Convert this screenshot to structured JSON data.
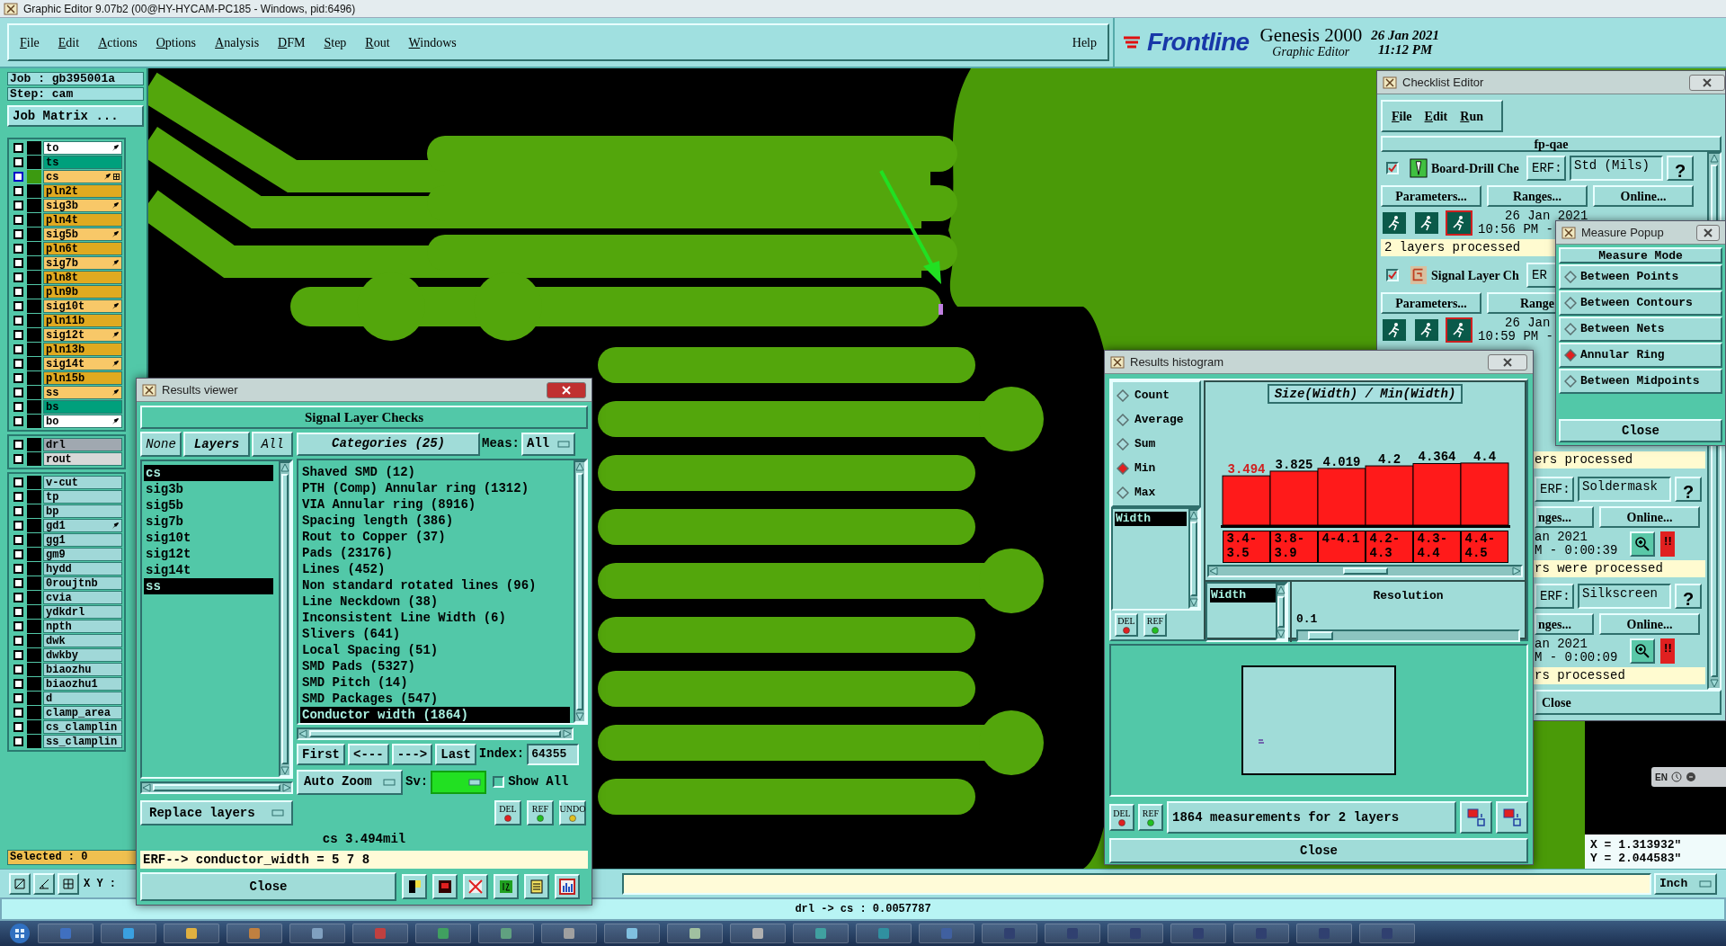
{
  "window": {
    "title": "Graphic Editor 9.07b2 (00@HY-HYCAM-PC185 - Windows, pid:6496)"
  },
  "menu": [
    "File",
    "Edit",
    "Actions",
    "Options",
    "Analysis",
    "DFM",
    "Step",
    "Rout",
    "Windows"
  ],
  "help": "Help",
  "brand": {
    "logo": "Frontline",
    "product": "Genesis 2000",
    "subtitle": "Graphic Editor",
    "date": "26 Jan 2021",
    "time": "11:12 PM"
  },
  "job": {
    "job": "Job : gb395001a",
    "step": "Step: cam",
    "matrix_button": "Job Matrix ..."
  },
  "layer_groups": [
    {
      "layers": [
        {
          "name": "to",
          "color": "#ffffff",
          "checked": false,
          "marked": true,
          "active": false
        },
        {
          "name": "ts",
          "color": "#00a07c",
          "checked": false,
          "marked": false,
          "active": false
        },
        {
          "name": "cs",
          "color": "#f8c868",
          "checked": false,
          "marked": true,
          "active": true
        },
        {
          "name": "pln2t",
          "color": "#e0aa20",
          "checked": false,
          "marked": false,
          "active": false
        },
        {
          "name": "sig3b",
          "color": "#f8c868",
          "checked": false,
          "marked": true,
          "active": false
        },
        {
          "name": "pln4t",
          "color": "#e0aa20",
          "checked": false,
          "marked": false,
          "active": false
        },
        {
          "name": "sig5b",
          "color": "#f8c868",
          "checked": false,
          "marked": true,
          "active": false
        },
        {
          "name": "pln6t",
          "color": "#e0aa20",
          "checked": false,
          "marked": false,
          "active": false
        },
        {
          "name": "sig7b",
          "color": "#f8c868",
          "checked": false,
          "marked": true,
          "active": false
        },
        {
          "name": "pln8t",
          "color": "#e0aa20",
          "checked": false,
          "marked": false,
          "active": false
        },
        {
          "name": "pln9b",
          "color": "#e0aa20",
          "checked": false,
          "marked": false,
          "active": false
        },
        {
          "name": "sig10t",
          "color": "#f8c868",
          "checked": false,
          "marked": true,
          "active": false
        },
        {
          "name": "pln11b",
          "color": "#e0aa20",
          "checked": false,
          "marked": false,
          "active": false
        },
        {
          "name": "sig12t",
          "color": "#f8c868",
          "checked": false,
          "marked": true,
          "active": false
        },
        {
          "name": "pln13b",
          "color": "#e0aa20",
          "checked": false,
          "marked": false,
          "active": false
        },
        {
          "name": "sig14t",
          "color": "#f8c868",
          "checked": false,
          "marked": true,
          "active": false
        },
        {
          "name": "pln15b",
          "color": "#e0aa20",
          "checked": false,
          "marked": false,
          "active": false
        },
        {
          "name": "ss",
          "color": "#f8c868",
          "checked": false,
          "marked": true,
          "active": false
        },
        {
          "name": "bs",
          "color": "#00a07c",
          "checked": false,
          "marked": false,
          "active": false
        },
        {
          "name": "bo",
          "color": "#ffffff",
          "checked": false,
          "marked": true,
          "active": false
        }
      ]
    },
    {
      "layers": [
        {
          "name": "drl",
          "color": "#a0a8b0",
          "checked": false,
          "marked": false,
          "active": false
        },
        {
          "name": "rout",
          "color": "#d8d8d8",
          "checked": false,
          "marked": false,
          "active": false
        }
      ]
    },
    {
      "layers": [
        {
          "name": "v-cut",
          "color": "#a0d8d8",
          "checked": false,
          "marked": false,
          "active": false
        },
        {
          "name": "tp",
          "color": "#a0d8d8",
          "checked": false,
          "marked": false,
          "active": false
        },
        {
          "name": "bp",
          "color": "#a0d8d8",
          "checked": false,
          "marked": false,
          "active": false
        },
        {
          "name": "gd1",
          "color": "#a0d8d8",
          "checked": false,
          "marked": true,
          "active": false
        },
        {
          "name": "gg1",
          "color": "#a0d8d8",
          "checked": false,
          "marked": false,
          "active": false
        },
        {
          "name": "gm9",
          "color": "#a0d8d8",
          "checked": false,
          "marked": false,
          "active": false
        },
        {
          "name": "hydd",
          "color": "#a0d8d8",
          "checked": false,
          "marked": false,
          "active": false
        },
        {
          "name": "0roujtnb",
          "color": "#a0d8d8",
          "checked": false,
          "marked": false,
          "active": false
        },
        {
          "name": "cvia",
          "color": "#a0d8d8",
          "checked": false,
          "marked": false,
          "active": false
        },
        {
          "name": "ydkdrl",
          "color": "#a0d8d8",
          "checked": false,
          "marked": false,
          "active": false
        },
        {
          "name": "npth",
          "color": "#a0d8d8",
          "checked": false,
          "marked": false,
          "active": false
        },
        {
          "name": "dwk",
          "color": "#a0d8d8",
          "checked": false,
          "marked": false,
          "active": false
        },
        {
          "name": "dwkby",
          "color": "#a0d8d8",
          "checked": false,
          "marked": false,
          "active": false
        },
        {
          "name": "biaozhu",
          "color": "#a0d8d8",
          "checked": false,
          "marked": false,
          "active": false
        },
        {
          "name": "biaozhu1",
          "color": "#a0d8d8",
          "checked": false,
          "marked": false,
          "active": false
        },
        {
          "name": "d",
          "color": "#a0d8d8",
          "checked": false,
          "marked": false,
          "active": false
        },
        {
          "name": "clamp_area",
          "color": "#a0d8d8",
          "checked": false,
          "marked": false,
          "active": false
        },
        {
          "name": "cs_clamplin",
          "color": "#a0d8d8",
          "checked": false,
          "marked": false,
          "active": false
        },
        {
          "name": "ss_clamplin",
          "color": "#a0d8d8",
          "checked": false,
          "marked": false,
          "active": false
        }
      ]
    }
  ],
  "selected_count": "Selected : 0",
  "toolbar": {
    "xy_label": "X Y :",
    "units": "Inch"
  },
  "status_bar": "drl -> cs : 0.0057787",
  "coordinates": {
    "language": "EN",
    "x": "X = 1.313932\"",
    "y": "Y = 2.044583\""
  },
  "results_viewer": {
    "title": "Results viewer",
    "heading": "Signal Layer Checks",
    "layer_buttons": [
      "None",
      "Layers",
      "All"
    ],
    "layers": [
      {
        "label": "cs",
        "selected": true
      },
      {
        "label": "sig3b",
        "selected": false
      },
      {
        "label": "sig5b",
        "selected": false
      },
      {
        "label": "sig7b",
        "selected": false
      },
      {
        "label": "sig10t",
        "selected": false
      },
      {
        "label": "sig12t",
        "selected": false
      },
      {
        "label": "sig14t",
        "selected": false
      },
      {
        "label": "ss",
        "selected": true
      }
    ],
    "categories_button": "Categories (25)",
    "meas_label": "Meas:",
    "meas_value": "All",
    "categories": [
      {
        "label": "Shaved SMD (12)",
        "selected": false
      },
      {
        "label": "PTH (Comp) Annular ring (1312)",
        "selected": false
      },
      {
        "label": "VIA Annular ring (8916)",
        "selected": false
      },
      {
        "label": "Spacing length (386)",
        "selected": false
      },
      {
        "label": "Rout to Copper (37)",
        "selected": false
      },
      {
        "label": "Pads (23176)",
        "selected": false
      },
      {
        "label": "Lines (452)",
        "selected": false
      },
      {
        "label": "Non standard rotated lines (96)",
        "selected": false
      },
      {
        "label": "Line Neckdown (38)",
        "selected": false
      },
      {
        "label": "Inconsistent Line Width (6)",
        "selected": false
      },
      {
        "label": "Slivers (641)",
        "selected": false
      },
      {
        "label": "Local Spacing (51)",
        "selected": false
      },
      {
        "label": "SMD Pads (5327)",
        "selected": false
      },
      {
        "label": "SMD Pitch (14)",
        "selected": false
      },
      {
        "label": "SMD Packages (547)",
        "selected": false
      },
      {
        "label": "Conductor width (1864)",
        "selected": true
      }
    ],
    "nav": [
      "First",
      "<---",
      "--->",
      "Last"
    ],
    "index_label": "Index:",
    "index_value": "64355",
    "zoom_mode": "Auto Zoom",
    "sv_label": "Sv:",
    "show_all": {
      "label": "Show All",
      "checked": false
    },
    "replace_mode": "Replace layers",
    "edit_buttons": [
      "DEL",
      "REF",
      "UNDO"
    ],
    "measurement": "cs 3.494mil",
    "erf_line": "ERF--> conductor_width = 5 7 8",
    "close": "Close"
  },
  "histogram": {
    "title": "Results histogram",
    "modes": [
      {
        "label": "Count",
        "selected": false
      },
      {
        "label": "Average",
        "selected": false
      },
      {
        "label": "Sum",
        "selected": false
      },
      {
        "label": "Min",
        "selected": true
      },
      {
        "label": "Max",
        "selected": false
      }
    ],
    "fields": [
      {
        "label": "Width",
        "selected": true
      }
    ],
    "edit_buttons": [
      "DEL",
      "REF"
    ],
    "chart_data": {
      "type": "bar",
      "title": "Size(Width) / Min(Width)",
      "categories": [
        "3.4-3.5",
        "3.8-3.9",
        "4-4.1",
        "4.2-4.3",
        "4.3-4.4",
        "4.4-4.5"
      ],
      "values": [
        3.494,
        3.825,
        4.019,
        4.2,
        4.364,
        4.4
      ],
      "data_labels": true
    },
    "axis_fields": [
      {
        "label": "Width",
        "selected": true
      }
    ],
    "resolution": {
      "label": "Resolution",
      "value": "0.1",
      "level": 0.1
    },
    "footer_buttons": [
      "DEL",
      "REF"
    ],
    "summary": "1864 measurements for 2 layers",
    "close": "Close"
  },
  "checklist_editor": {
    "title": "Checklist Editor",
    "menu": [
      "File",
      "Edit",
      "Run"
    ],
    "checklist": "fp-qae",
    "checks": [
      {
        "kind": "full",
        "checked": true,
        "name": "Board-Drill Che",
        "erf": "ERF:",
        "erf_value": "Std (Mils)",
        "help": "?",
        "buttons": [
          "Parameters...",
          "Ranges...",
          "Online..."
        ],
        "date": "26 Jan 2021",
        "time": "10:56 PM -",
        "status": "2 layers processed"
      },
      {
        "kind": "full",
        "checked": true,
        "name": "Signal Layer Ch",
        "erf": "ER",
        "buttons": [
          "Parameters...",
          "Range"
        ],
        "date": "26 Jan",
        "time": "10:59 PM -"
      },
      {
        "kind": "partial",
        "status": "ers processed"
      },
      {
        "kind": "partial",
        "erf": "ERF:",
        "erf_value": "Soldermask",
        "help": "?",
        "buttons": [
          "nges...",
          "Online..."
        ],
        "date": "an 2021",
        "time": "M - 0:00:39",
        "alert": "!!",
        "status": "rs were processed"
      },
      {
        "kind": "partial",
        "erf": "ERF:",
        "erf_value": "Silkscreen",
        "help": "?",
        "buttons": [
          "nges...",
          "Online..."
        ],
        "date": "an 2021",
        "time": "M - 0:00:09",
        "alert": "!!",
        "status": "rs processed"
      }
    ],
    "close": "Close"
  },
  "measure_popup": {
    "title": "Measure Popup",
    "heading": "Measure Mode",
    "modes": [
      {
        "label": "Between Points",
        "selected": false
      },
      {
        "label": "Between Contours",
        "selected": false
      },
      {
        "label": "Between Nets",
        "selected": false
      },
      {
        "label": "Annular Ring",
        "selected": true
      },
      {
        "label": "Between Midpoints",
        "selected": false
      }
    ],
    "close": "Close"
  }
}
